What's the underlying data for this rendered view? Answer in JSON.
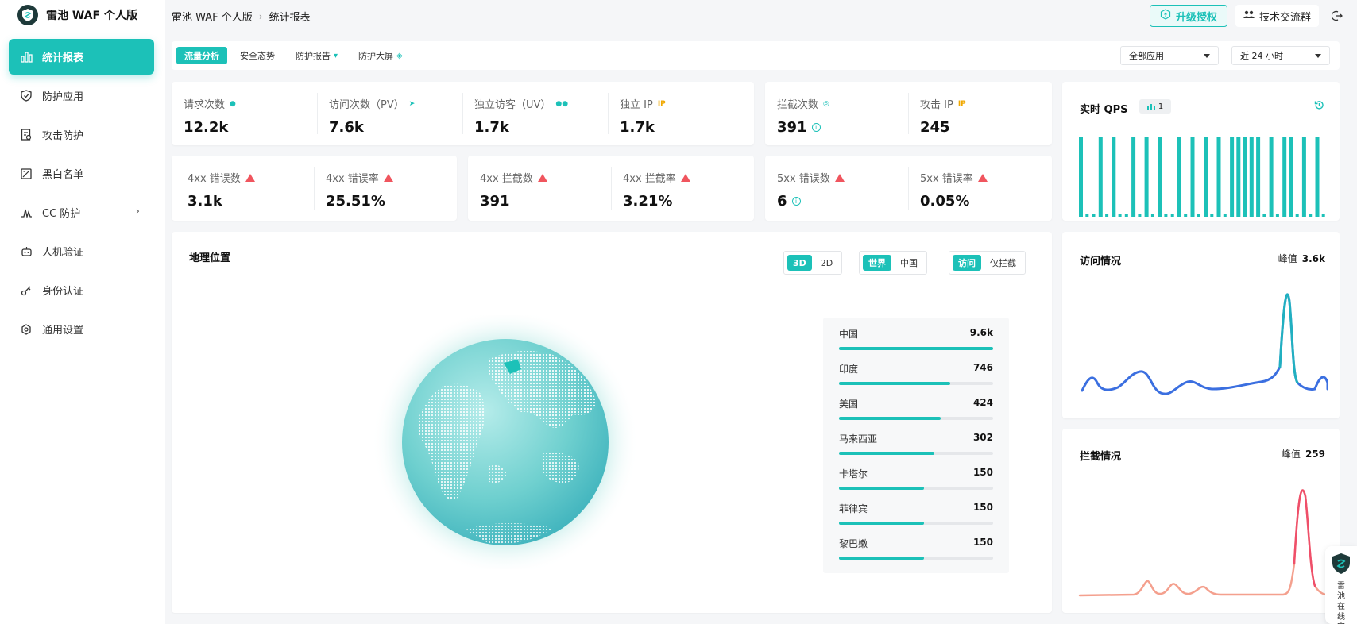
{
  "app": {
    "title": "雷池 WAF 个人版"
  },
  "breadcrumb": {
    "root": "雷池 WAF 个人版",
    "current": "统计报表"
  },
  "header": {
    "upgrade_label": "升级授权",
    "tech_label": "技术交流群"
  },
  "sidebar": {
    "items": [
      {
        "label": "统计报表",
        "icon": "bar-chart-icon",
        "active": true
      },
      {
        "label": "防护应用",
        "icon": "shield-icon"
      },
      {
        "label": "攻击防护",
        "icon": "doc-shield-icon"
      },
      {
        "label": "黑白名单",
        "icon": "list-icon"
      },
      {
        "label": "CC 防护",
        "icon": "pulse-icon"
      },
      {
        "label": "人机验证",
        "icon": "robot-icon"
      },
      {
        "label": "身份认证",
        "icon": "key-icon"
      },
      {
        "label": "通用设置",
        "icon": "gear-icon"
      }
    ]
  },
  "tabs": [
    "流量分析",
    "安全态势",
    "防护报告",
    "防护大屏"
  ],
  "filters": {
    "app": "全部应用",
    "range": "近 24 小时"
  },
  "stats_row1_left": [
    {
      "label": "请求次数",
      "value": "12.2k"
    },
    {
      "label": "访问次数（PV）",
      "value": "7.6k"
    },
    {
      "label": "独立访客（UV）",
      "value": "1.7k"
    },
    {
      "label": "独立 IP",
      "value": "1.7k",
      "tag": "IP"
    }
  ],
  "stats_row1_right": [
    {
      "label": "拦截次数",
      "value": "391"
    },
    {
      "label": "攻击 IP",
      "value": "245",
      "tag": "IP"
    }
  ],
  "stats_row2": [
    {
      "label": "4xx 错误数",
      "value": "3.1k"
    },
    {
      "label": "4xx 错误率",
      "value": "25.51%"
    },
    {
      "label": "4xx 拦截数",
      "value": "391"
    },
    {
      "label": "4xx 拦截率",
      "value": "3.21%"
    },
    {
      "label": "5xx 错误数",
      "value": "6"
    },
    {
      "label": "5xx 错误率",
      "value": "0.05%"
    }
  ],
  "geo": {
    "title": "地理位置",
    "toggle_view": [
      "3D",
      "2D"
    ],
    "toggle_scope": [
      "世界",
      "中国"
    ],
    "toggle_type": [
      "访问",
      "仅拦截"
    ],
    "ranking": [
      {
        "name": "中国",
        "count": "9.6k",
        "fill": 1.0
      },
      {
        "name": "印度",
        "count": "746",
        "fill": 0.72
      },
      {
        "name": "美国",
        "count": "424",
        "fill": 0.66
      },
      {
        "name": "马来西亚",
        "count": "302",
        "fill": 0.62
      },
      {
        "name": "卡塔尔",
        "count": "150",
        "fill": 0.55
      },
      {
        "name": "菲律宾",
        "count": "150",
        "fill": 0.55
      },
      {
        "name": "黎巴嫩",
        "count": "150",
        "fill": 0.55
      }
    ]
  },
  "qps": {
    "title": "实时 QPS",
    "badge": "1"
  },
  "visits": {
    "title": "访问情况",
    "peak_label": "峰值",
    "peak_value": "3.6k"
  },
  "blocks": {
    "title": "拦截情况",
    "peak_label": "峰值",
    "peak_value": "259"
  },
  "support": {
    "label": "雷池在线客服"
  },
  "colors": {
    "accent": "#1cc1b8",
    "visit_line": "#3b6fe0",
    "block_line": "#f07a6a",
    "warn": "#f0555e"
  }
}
